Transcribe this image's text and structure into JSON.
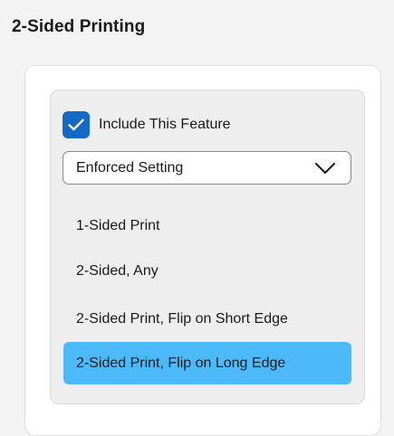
{
  "section": {
    "title": "2-Sided Printing"
  },
  "feature": {
    "include_label": "Include This Feature",
    "include_checked": true
  },
  "setting_dropdown": {
    "value": "Enforced Setting",
    "icon": "chevron-down-icon"
  },
  "options": [
    {
      "label": "1-Sided Print",
      "selected": false
    },
    {
      "label": "2-Sided, Any",
      "selected": false
    },
    {
      "label": "2-Sided Print, Flip on Short Edge",
      "selected": false
    },
    {
      "label": "2-Sided Print, Flip on Long Edge",
      "selected": true
    }
  ],
  "colors": {
    "checkbox_accent": "#1469c7",
    "selected_option_bg": "#4cb9f8"
  }
}
